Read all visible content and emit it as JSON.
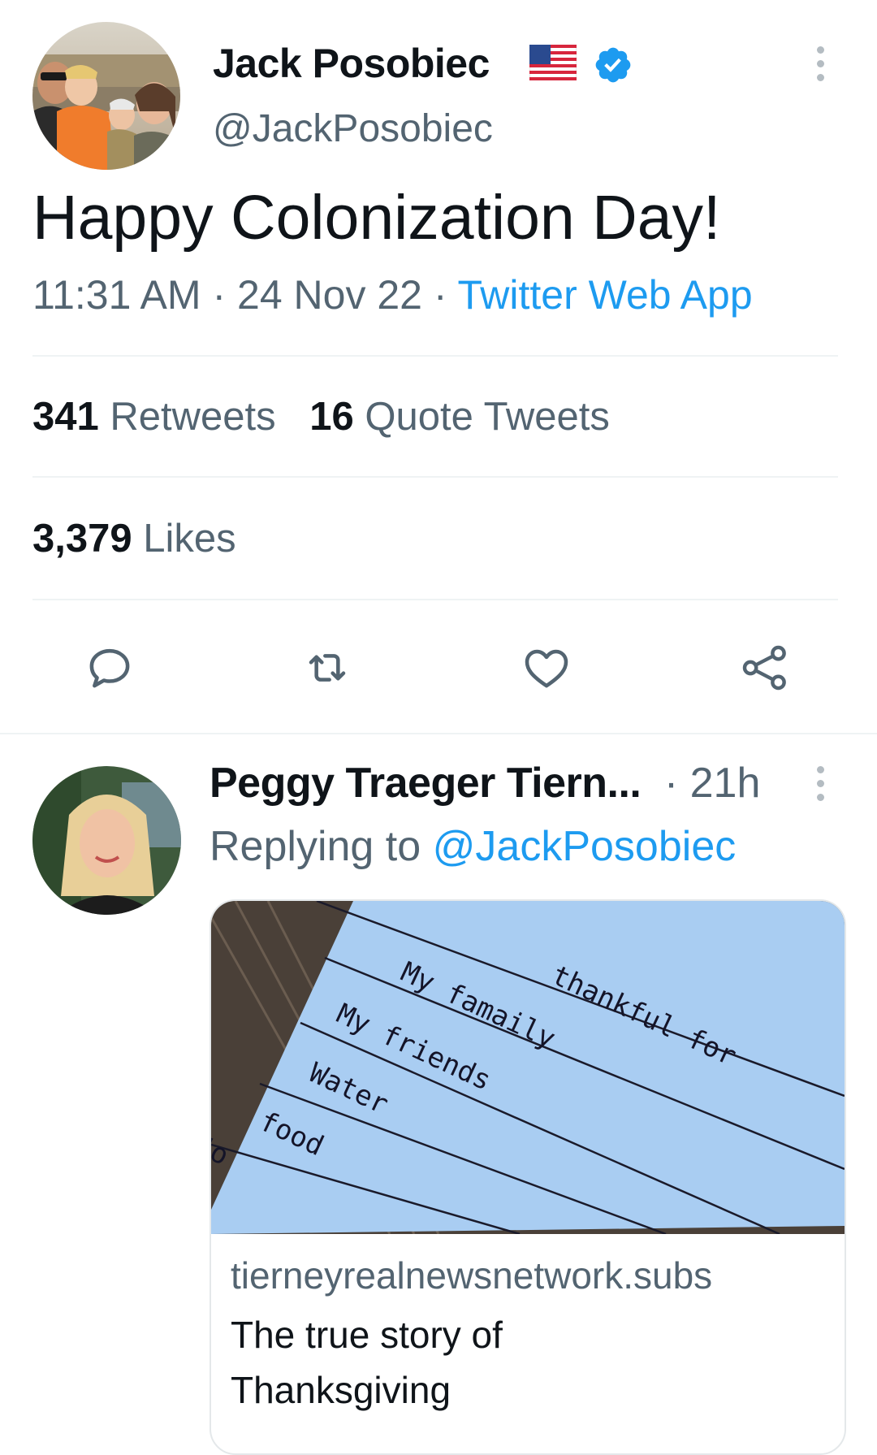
{
  "tweet": {
    "author_name": "Jack Posobiec",
    "author_handle": "@JackPosobiec",
    "text": "Happy Colonization Day!",
    "time": "11:31 AM",
    "date": "24 Nov 22",
    "separator": "·",
    "source": "Twitter Web App",
    "retweets_count": "341",
    "retweets_label": "Retweets",
    "quote_count": "16",
    "quote_label": "Quote Tweets",
    "likes_count": "3,379",
    "likes_label": "Likes"
  },
  "reply": {
    "author_name": "Peggy Traeger Tiern...",
    "time_sep": "·",
    "time": "21h",
    "replying_label": "Replying to",
    "replying_handle": "@JackPosobiec",
    "card": {
      "image_lines": [
        "thankful for",
        "My famaily",
        "My friends",
        "Water",
        "food",
        "Jo"
      ],
      "domain": "tierneyrealnewsnetwork.subs",
      "title": "The true story of Thanksgiving"
    }
  },
  "icons": {
    "more": "more-vertical-icon",
    "flag": "us-flag-icon",
    "verified": "verified-badge-icon",
    "reply": "reply-icon",
    "retweet": "retweet-icon",
    "like": "heart-icon",
    "share": "share-icon"
  },
  "colors": {
    "accent": "#1d9bf0",
    "text": "#0f1419",
    "muted": "#536471"
  }
}
